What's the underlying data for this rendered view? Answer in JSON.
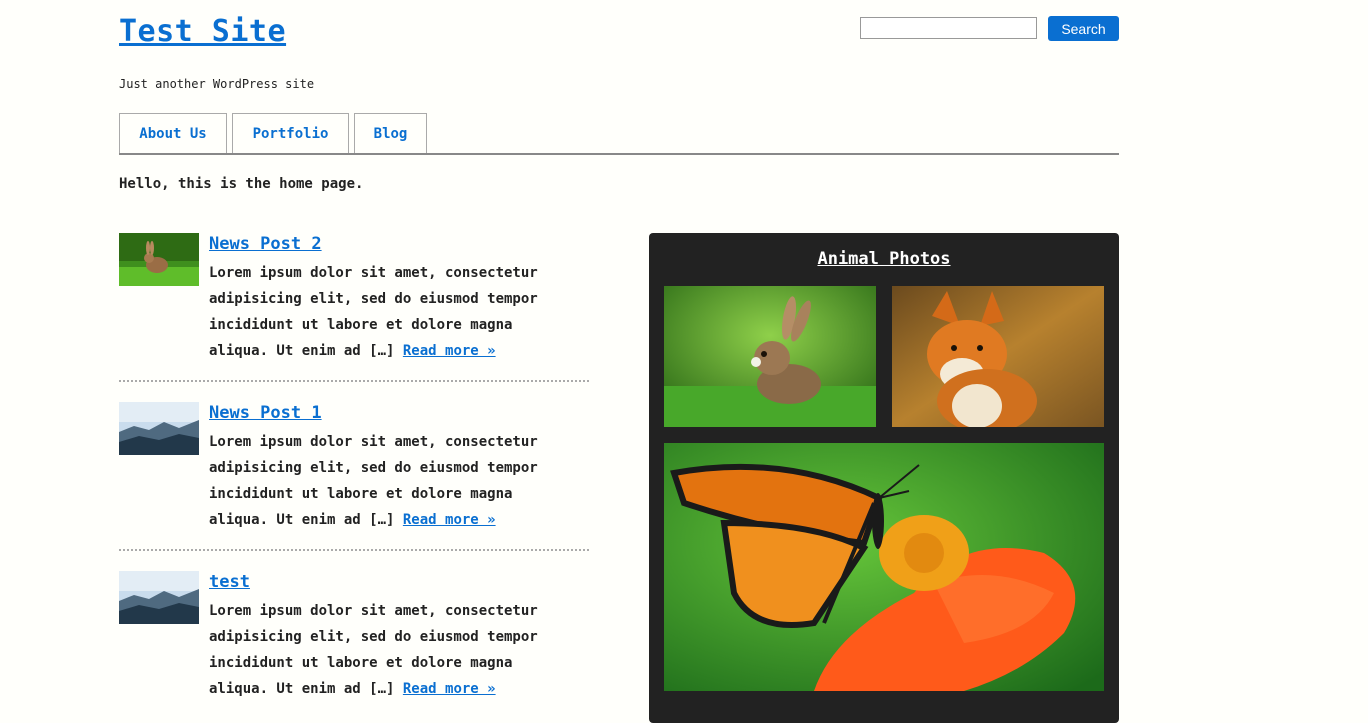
{
  "site": {
    "title": "Test Site",
    "tagline": "Just another WordPress site"
  },
  "search": {
    "placeholder": "",
    "value": "",
    "button_label": "Search"
  },
  "nav": {
    "tabs": [
      {
        "label": "About Us"
      },
      {
        "label": "Portfolio"
      },
      {
        "label": "Blog"
      }
    ]
  },
  "main": {
    "intro": "Hello, this is the home page."
  },
  "posts": [
    {
      "title": "News Post 2",
      "excerpt": "Lorem ipsum dolor sit amet, consectetur adipisicing elit, sed do eiusmod tempor incididunt ut labore et dolore magna aliqua. Ut enim ad […]",
      "read_more": "Read more »",
      "thumb_icon": "rabbit-thumbnail"
    },
    {
      "title": "News Post 1",
      "excerpt": "Lorem ipsum dolor sit amet, consectetur adipisicing elit, sed do eiusmod tempor incididunt ut labore et dolore magna aliqua. Ut enim ad […]",
      "read_more": "Read more »",
      "thumb_icon": "foggy-forest-thumbnail"
    },
    {
      "title": "test",
      "excerpt": "Lorem ipsum dolor sit amet, consectetur adipisicing elit, sed do eiusmod tempor incididunt ut labore et dolore magna aliqua. Ut enim ad […]",
      "read_more": "Read more »",
      "thumb_icon": "foggy-forest-thumbnail"
    }
  ],
  "widget": {
    "title": "Animal Photos",
    "photos": [
      {
        "icon": "rabbit-photo"
      },
      {
        "icon": "fox-photo"
      },
      {
        "icon": "butterfly-photo"
      }
    ]
  },
  "colors": {
    "accent": "#0a6fd1",
    "background": "#fffffb",
    "widget_bg": "#222222"
  }
}
